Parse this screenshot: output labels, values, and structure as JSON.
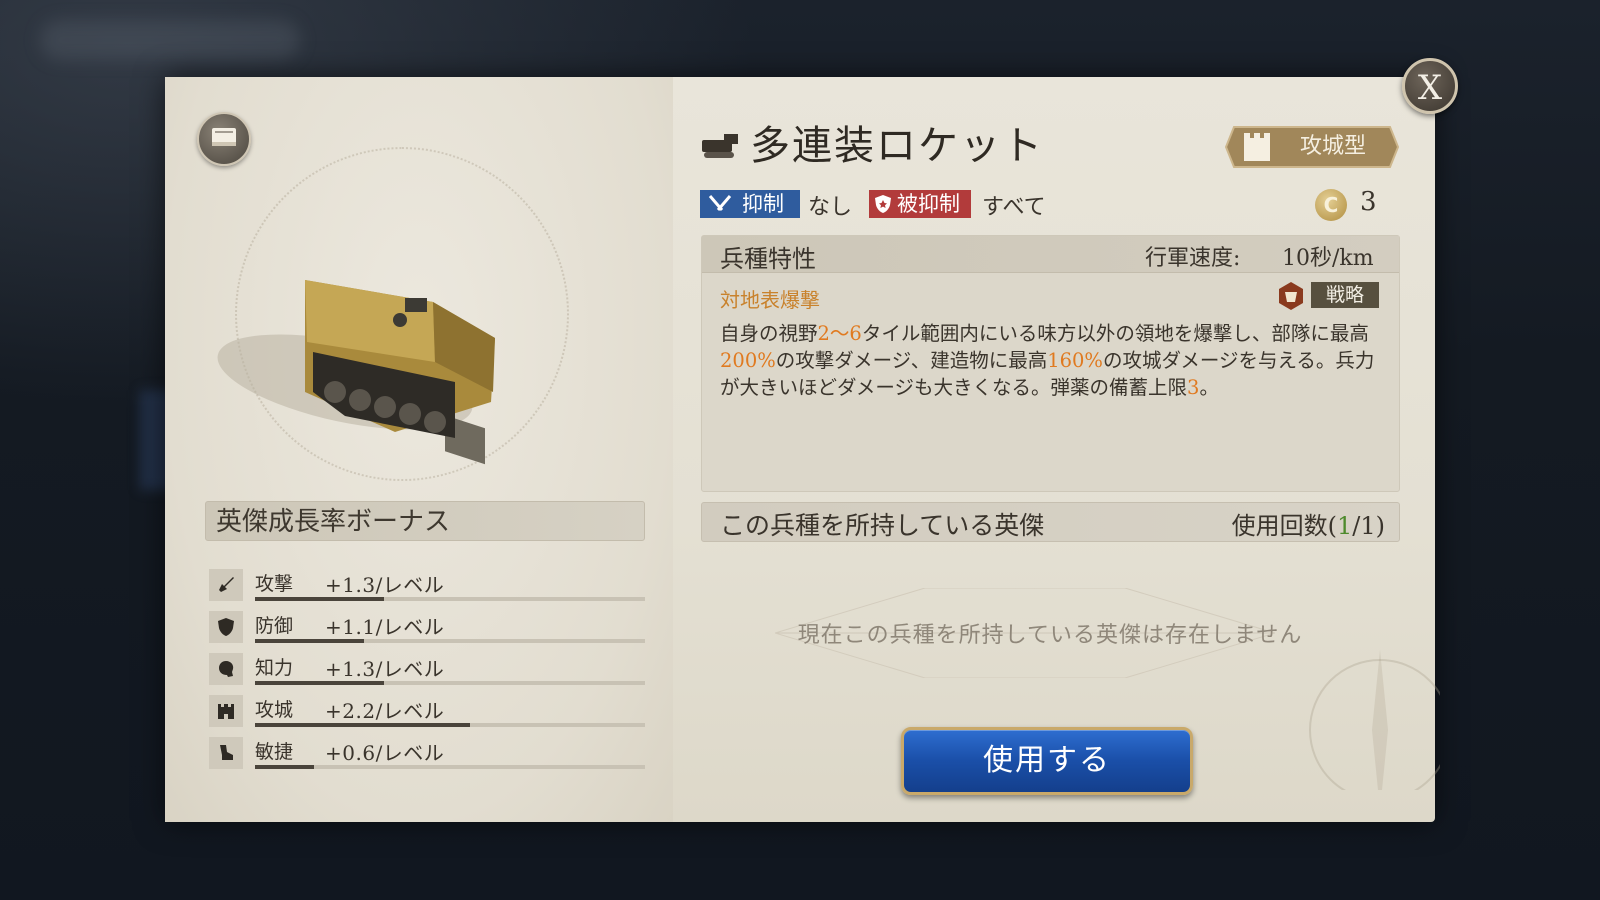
{
  "close_label": "X",
  "unit": {
    "name": "多連装ロケット",
    "type_label": "攻城型",
    "suppress_label": "抑制",
    "suppress_value": "なし",
    "suppressed_label": "被抑制",
    "suppressed_value": "すべて",
    "cost_symbol": "C",
    "cost": "3"
  },
  "traits": {
    "title": "兵種特性",
    "speed_label": "行軍速度:",
    "speed_value": "10秒/km",
    "skill_name": "対地表爆撃",
    "skill_tag": "戦略",
    "desc": {
      "p1": "自身の視野",
      "h1": "2～6",
      "p2": "タイル範囲内にいる味方以外の領地を爆撃し、部隊に最高",
      "h2": "200%",
      "p3": "の攻撃ダメージ、建造物に最高",
      "h3": "160%",
      "p4": "の攻城ダメージを与える。兵力が大きいほどダメージも大きくなる。弾薬の備蓄上限",
      "h4": "3",
      "p5": "。"
    }
  },
  "bonus": {
    "title": "英傑成長率ボーナス",
    "stats": [
      {
        "name": "攻撃",
        "value": "+1.3/レベル",
        "fill": 0.33,
        "icon": "sword-icon"
      },
      {
        "name": "防御",
        "value": "+1.1/レベル",
        "fill": 0.28,
        "icon": "shield-icon"
      },
      {
        "name": "知力",
        "value": "+1.3/レベル",
        "fill": 0.33,
        "icon": "head-icon"
      },
      {
        "name": "攻城",
        "value": "+2.2/レベル",
        "fill": 0.55,
        "icon": "castle-icon"
      },
      {
        "name": "敏捷",
        "value": "+0.6/レベル",
        "fill": 0.15,
        "icon": "boot-icon"
      }
    ]
  },
  "heroes": {
    "title": "この兵種を所持している英傑",
    "usage_prefix": "使用回数(",
    "usage_used": "1",
    "usage_suffix": "/1)",
    "empty_text": "現在この兵種を所持している英傑は存在しません"
  },
  "use_button": "使用する",
  "colors": {
    "suppress": "#2f5c9e",
    "suppressed": "#b23b3b",
    "highlight": "#e07a20",
    "button": "#1a4fa8",
    "usage_green": "#4e8a2c"
  }
}
